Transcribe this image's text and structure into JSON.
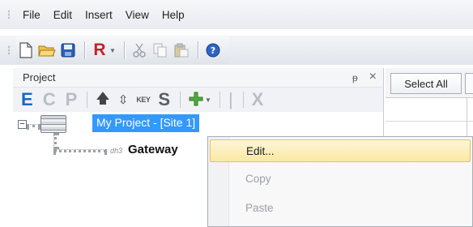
{
  "menubar": {
    "items": [
      "File",
      "Edit",
      "Insert",
      "View",
      "Help"
    ]
  },
  "toolbar": {
    "icons": [
      "new-document-icon",
      "open-folder-icon",
      "save-icon",
      "r-icon",
      "cut-icon",
      "copy-icon",
      "paste-icon",
      "help-icon"
    ],
    "r_label": "R"
  },
  "project_pane": {
    "title": "Project",
    "pin_glyph": "ᵽ",
    "close_glyph": "×",
    "tool_letters": {
      "e": "E",
      "c": "C",
      "p": "P",
      "s": "S",
      "x": "X"
    },
    "key_label": "KEY",
    "tree": {
      "expander": "−",
      "project_label": "My Project - [Site 1]",
      "device_tag": "dh3",
      "gateway_label": "Gateway"
    }
  },
  "right_pane": {
    "select_all_label": "Select All"
  },
  "context_menu": {
    "items": [
      {
        "label": "Edit...",
        "state": "highlighted"
      },
      {
        "label": "Copy",
        "state": "disabled"
      },
      {
        "label": "Paste",
        "state": "disabled"
      }
    ]
  },
  "colors": {
    "selection_blue": "#3399ff",
    "menu_highlight": "#fbe8a3",
    "letter_blue": "#1f64c0"
  }
}
